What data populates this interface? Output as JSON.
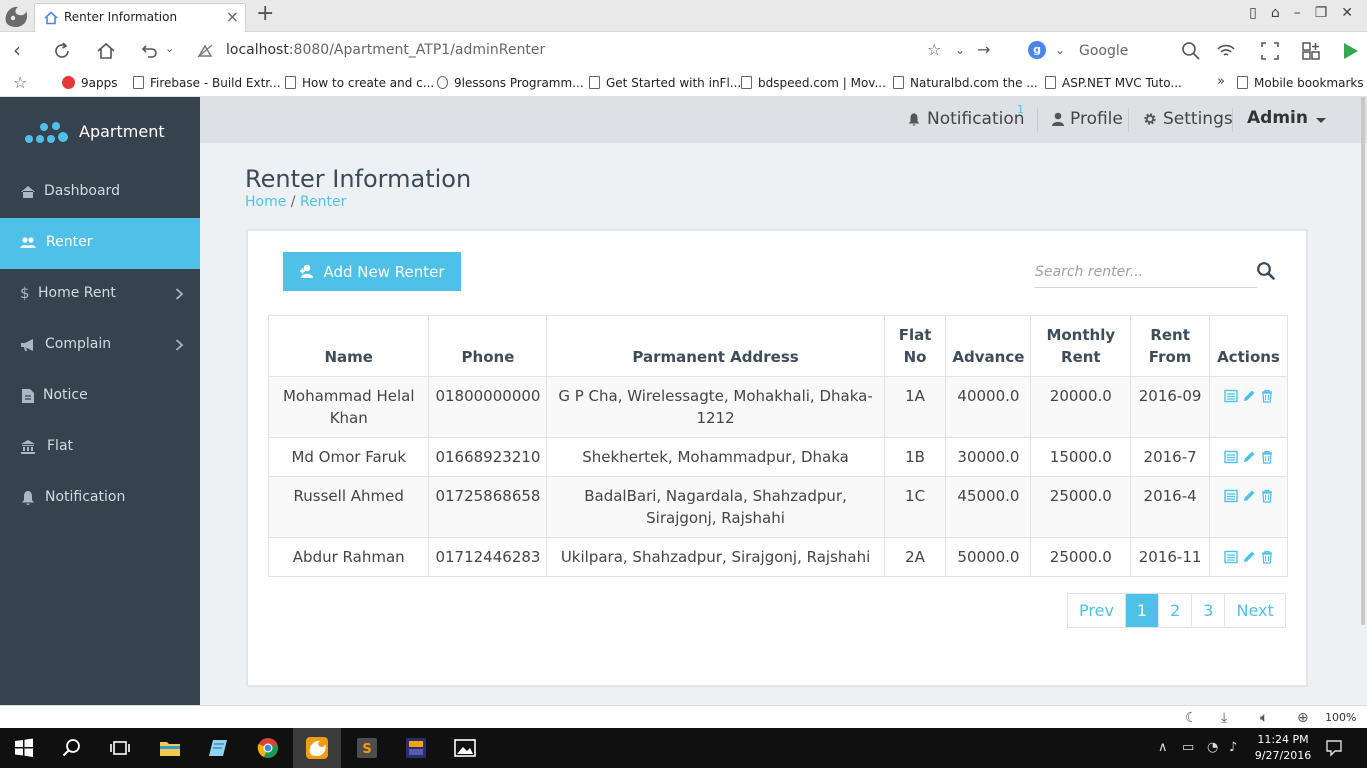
{
  "browser": {
    "tab_title": "Renter Information",
    "url_host": "localhost",
    "url_rest": ":8080/Apartment_ATP1/adminRenter",
    "search_engine_letter": "g",
    "search_placeholder": "Google",
    "bookmarks": [
      {
        "label": "9apps",
        "icon": "9apps-icon"
      },
      {
        "label": "Firebase - Build Extr...",
        "icon": "page-icon"
      },
      {
        "label": "How to create and c...",
        "icon": "page-icon"
      },
      {
        "label": "9lessons Programm...",
        "icon": "globe-icon"
      },
      {
        "label": "Get Started with inFl...",
        "icon": "page-icon"
      },
      {
        "label": "bdspeed.com | Mov...",
        "icon": "page-icon"
      },
      {
        "label": "Naturalbd.com the ...",
        "icon": "page-icon"
      },
      {
        "label": "ASP.NET MVC Tuto...",
        "icon": "page-icon"
      }
    ],
    "bookmarks_more": "»",
    "mobile_bookmarks": "Mobile bookmarks",
    "zoom": "100%"
  },
  "app": {
    "brand": "Apartment",
    "sidebar": [
      {
        "label": "Dashboard",
        "icon": "dashboard-icon",
        "active": false,
        "has_submenu": false
      },
      {
        "label": "Renter",
        "icon": "users-icon",
        "active": true,
        "has_submenu": false
      },
      {
        "label": "Home Rent",
        "icon": "dollar-icon",
        "active": false,
        "has_submenu": true
      },
      {
        "label": "Complain",
        "icon": "megaphone-icon",
        "active": false,
        "has_submenu": true
      },
      {
        "label": "Notice",
        "icon": "file-icon",
        "active": false,
        "has_submenu": false
      },
      {
        "label": "Flat",
        "icon": "bank-icon",
        "active": false,
        "has_submenu": false
      },
      {
        "label": "Notification",
        "icon": "bell-icon",
        "active": false,
        "has_submenu": false
      }
    ],
    "topbar": {
      "notification_label": "Notification",
      "notification_count": "1",
      "profile_label": "Profile",
      "settings_label": "Settings",
      "admin_label": "Admin"
    },
    "page_title": "Renter Information",
    "breadcrumb": {
      "home": "Home",
      "separator": "/",
      "current": "Renter"
    },
    "add_button_label": "Add New Renter",
    "search_placeholder": "Search renter...",
    "table": {
      "headers": [
        "Name",
        "Phone",
        "Parmanent Address",
        "Flat No",
        "Advance",
        "Monthly Rent",
        "Rent From",
        "Actions"
      ],
      "rows": [
        {
          "name": "Mohammad Helal Khan",
          "phone": "01800000000",
          "address": "G P Cha, Wirelessagte, Mohakhali, Dhaka-1212",
          "flat": "1A",
          "advance": "40000.0",
          "rent": "20000.0",
          "from": "2016-09"
        },
        {
          "name": "Md Omor Faruk",
          "phone": "01668923210",
          "address": "Shekhertek, Mohammadpur, Dhaka",
          "flat": "1B",
          "advance": "30000.0",
          "rent": "15000.0",
          "from": "2016-7"
        },
        {
          "name": "Russell Ahmed",
          "phone": "01725868658",
          "address": "BadalBari, Nagardala, Shahzadpur, Sirajgonj, Rajshahi",
          "flat": "1C",
          "advance": "45000.0",
          "rent": "25000.0",
          "from": "2016-4"
        },
        {
          "name": "Abdur Rahman",
          "phone": "01712446283",
          "address": "Ukilpara, Shahzadpur, Sirajgonj, Rajshahi",
          "flat": "2A",
          "advance": "50000.0",
          "rent": "25000.0",
          "from": "2016-11"
        }
      ]
    },
    "pagination": {
      "prev": "Prev",
      "pages": [
        "1",
        "2",
        "3"
      ],
      "active_page": "1",
      "next": "Next"
    },
    "colors": {
      "accent": "#4fc1e9",
      "sidebar": "#37424f",
      "topbar": "#dde1e6",
      "background": "#eef1f4"
    }
  },
  "taskbar": {
    "time": "11:24 PM",
    "date": "9/27/2016"
  }
}
